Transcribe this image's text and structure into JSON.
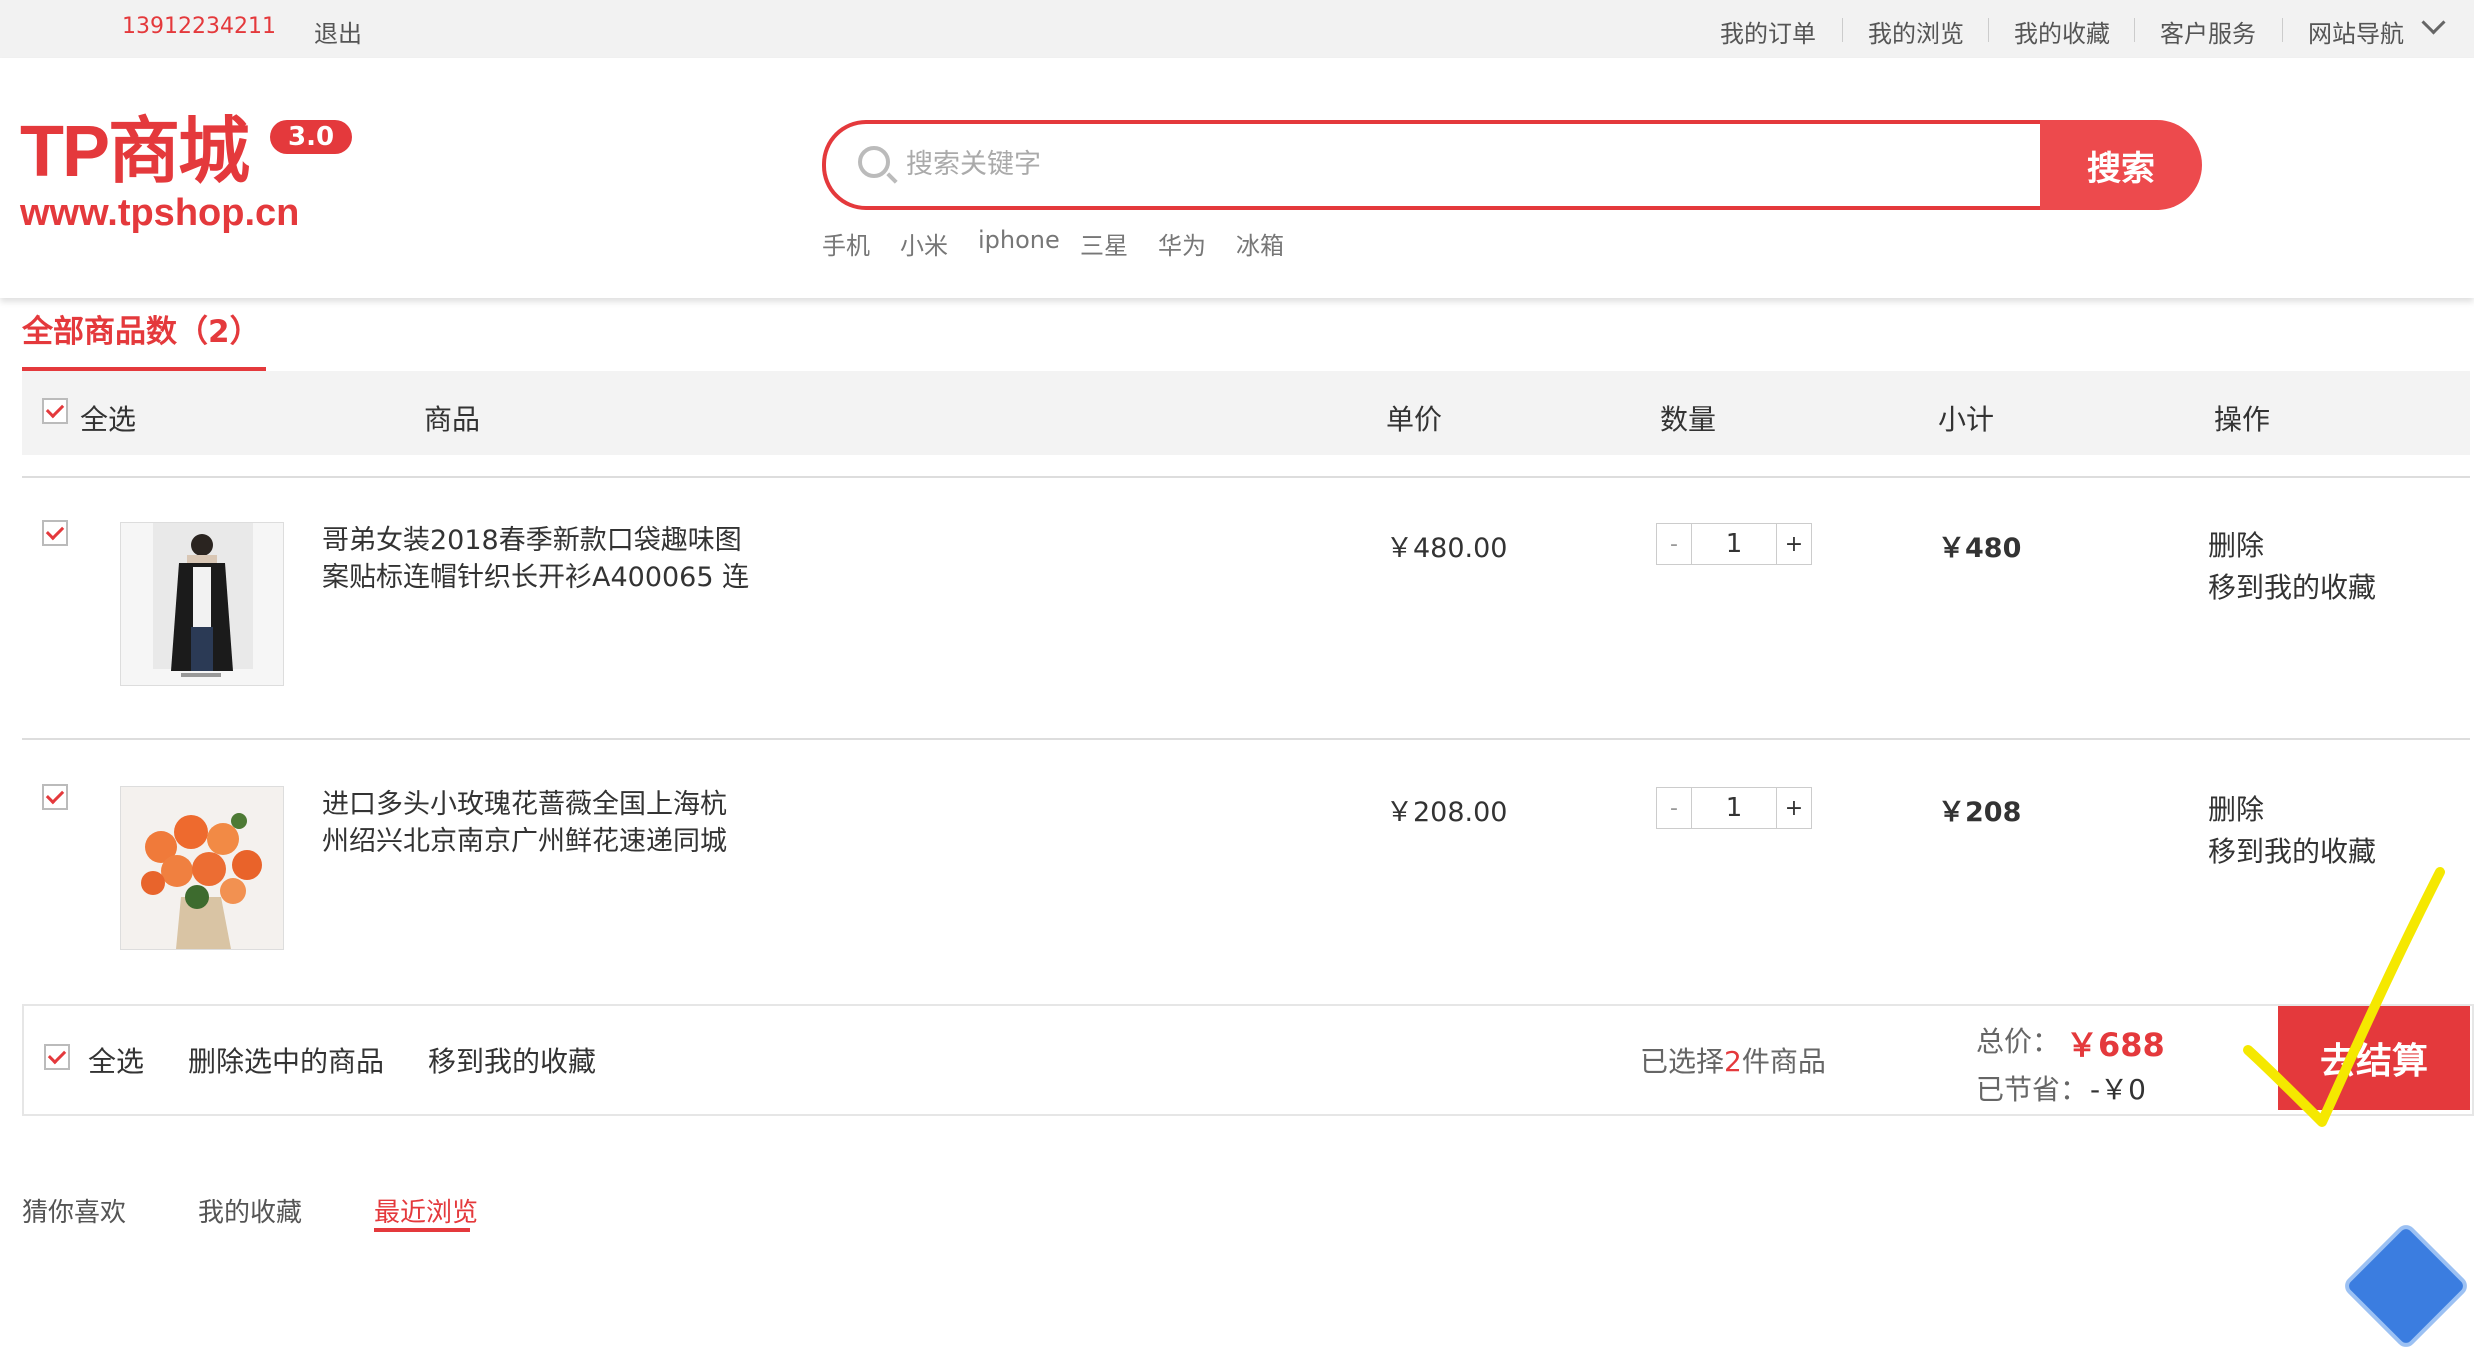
{
  "topbar": {
    "user_phone": "13912234211",
    "logout": "退出",
    "nav": [
      "我的订单",
      "我的浏览",
      "我的收藏",
      "客户服务",
      "网站导航"
    ]
  },
  "header": {
    "logo_text": "TP商城",
    "logo_version": "3.0",
    "logo_url": "www.tpshop.cn",
    "search_placeholder": "搜索关键字",
    "search_button": "搜索",
    "hot_words": [
      "手机",
      "小米",
      "iphone",
      "三星",
      "华为",
      "冰箱"
    ]
  },
  "cart": {
    "title": "全部商品数（2）",
    "columns": {
      "select_all": "全选",
      "product": "商品",
      "unit_price": "单价",
      "quantity": "数量",
      "subtotal": "小计",
      "action": "操作"
    },
    "items": [
      {
        "name": "哥弟女装2018春季新款口袋趣味图案贴标连帽针织长开衫A400065 连",
        "name_line1": "哥弟女装2018春季新款口袋趣味图",
        "name_line2": "案贴标连帽针织长开衫A400065 连",
        "price": "￥480.00",
        "quantity": "1",
        "subtotal": "￥480",
        "delete": "删除",
        "favorite": "移到我的收藏"
      },
      {
        "name": "进口多头小玫瑰花蔷薇全国上海杭州绍兴北京南京广州鲜花速递同城",
        "name_line1": "进口多头小玫瑰花蔷薇全国上海杭",
        "name_line2": "州绍兴北京南京广州鲜花速递同城",
        "price": "￥208.00",
        "quantity": "1",
        "subtotal": "￥208",
        "delete": "删除",
        "favorite": "移到我的收藏"
      }
    ],
    "stepper_minus": "-",
    "stepper_plus": "+",
    "footer": {
      "select_all": "全选",
      "delete_selected": "删除选中的商品",
      "move_to_favorites": "移到我的收藏",
      "selected_prefix": "已选择",
      "selected_count": "2",
      "selected_suffix": "件商品",
      "total_label": "总价：",
      "total_value": "￥688",
      "saved_label": "已节省：",
      "saved_value": "-￥0",
      "checkout": "去结算"
    }
  },
  "bottom_tabs": [
    "猜你喜欢",
    "我的收藏",
    "最近浏览"
  ],
  "colors": {
    "accent": "#e4393c",
    "annotation": "#f5e800"
  }
}
